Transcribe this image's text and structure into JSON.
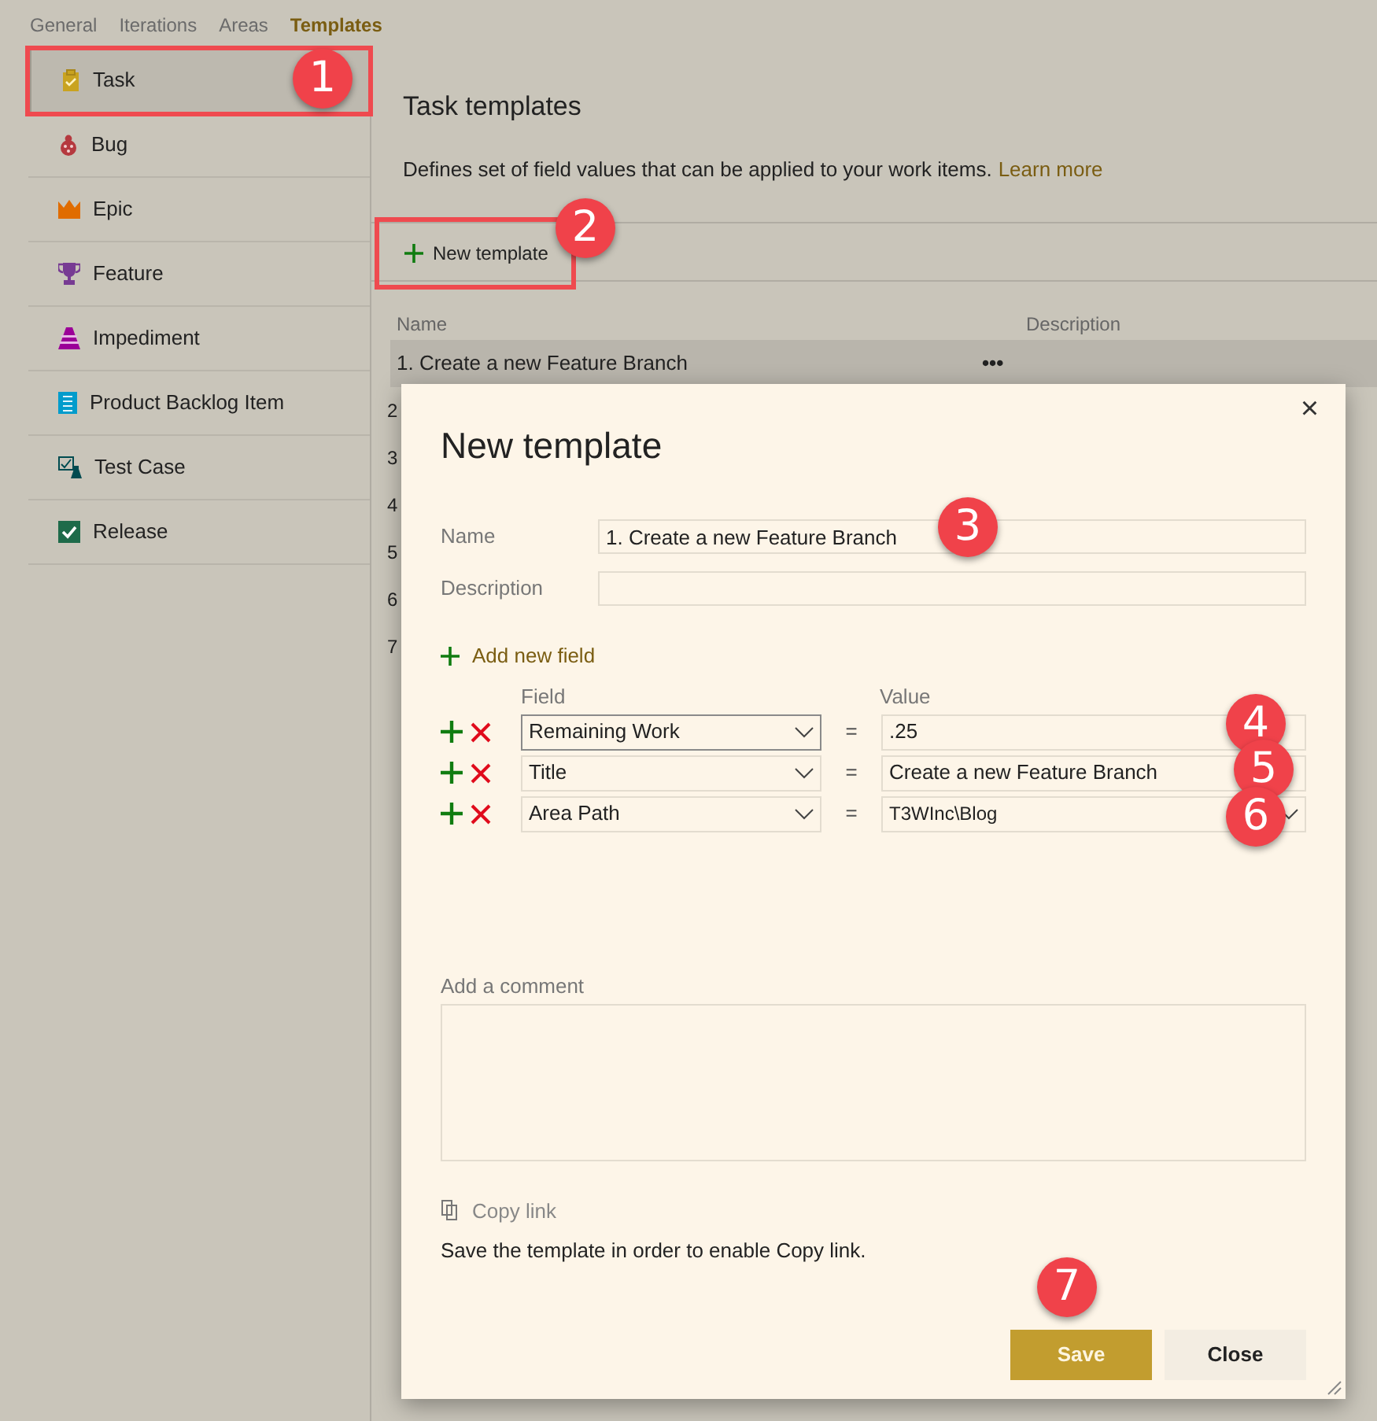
{
  "top_tabs": [
    {
      "label": "General",
      "selected": false
    },
    {
      "label": "Iterations",
      "selected": false
    },
    {
      "label": "Areas",
      "selected": false
    },
    {
      "label": "Templates",
      "selected": true
    }
  ],
  "sidebar": {
    "items": [
      {
        "label": "Task",
        "selected": true,
        "highlighted": true
      },
      {
        "label": "Bug",
        "selected": false,
        "highlighted": false
      },
      {
        "label": "Epic",
        "selected": false,
        "highlighted": false
      },
      {
        "label": "Feature",
        "selected": false,
        "highlighted": false
      },
      {
        "label": "Impediment",
        "selected": false,
        "highlighted": false
      },
      {
        "label": "Product Backlog Item",
        "selected": false,
        "highlighted": false
      },
      {
        "label": "Test Case",
        "selected": false,
        "highlighted": false
      },
      {
        "label": "Release",
        "selected": false,
        "highlighted": false
      }
    ]
  },
  "main": {
    "title": "Task templates",
    "description": "Defines set of field values that can be applied to your work items.",
    "learn_more": "Learn more",
    "toolbar": {
      "new_button": "New template",
      "highlighted": true
    },
    "table": {
      "columns": [
        "Name",
        "Description"
      ],
      "rows": [
        {
          "name": "1. Create a new Feature Branch",
          "menu": "•••",
          "selected": true
        },
        {
          "name": "2",
          "selected": false
        },
        {
          "name": "3",
          "selected": false
        },
        {
          "name": "4",
          "selected": false
        },
        {
          "name": "5",
          "selected": false
        },
        {
          "name": "6",
          "selected": false
        },
        {
          "name": "7",
          "selected": false
        }
      ]
    }
  },
  "dialog": {
    "title": "New template",
    "close": "×",
    "name_label": "Name",
    "name_value": "1. Create a new Feature Branch",
    "description_label": "Description",
    "add_field": "Add new field",
    "field_header": "Field",
    "value_header": "Value",
    "fields": [
      {
        "field": "Remaining Work",
        "equals": "=",
        "value": ".25",
        "kind": "text",
        "focused": true
      },
      {
        "field": "Title",
        "equals": "=",
        "value": "Create a new Feature Branch",
        "kind": "text",
        "focused": false
      },
      {
        "field": "Area Path",
        "equals": "=",
        "value": "T3WInc\\Blog",
        "kind": "dropdown",
        "focused": false
      }
    ],
    "comment_label": "Add a comment",
    "copy_link": "Copy link",
    "copy_note": "Save the template in order to enable Copy link.",
    "buttons": [
      {
        "label": "Save",
        "kind": "primary"
      },
      {
        "label": "Close",
        "kind": "secondary"
      }
    ]
  },
  "callouts": [
    {
      "label": "1"
    },
    {
      "label": "2"
    },
    {
      "label": "3"
    },
    {
      "label": "4"
    },
    {
      "label": "5"
    },
    {
      "label": "6"
    },
    {
      "label": "7"
    }
  ]
}
